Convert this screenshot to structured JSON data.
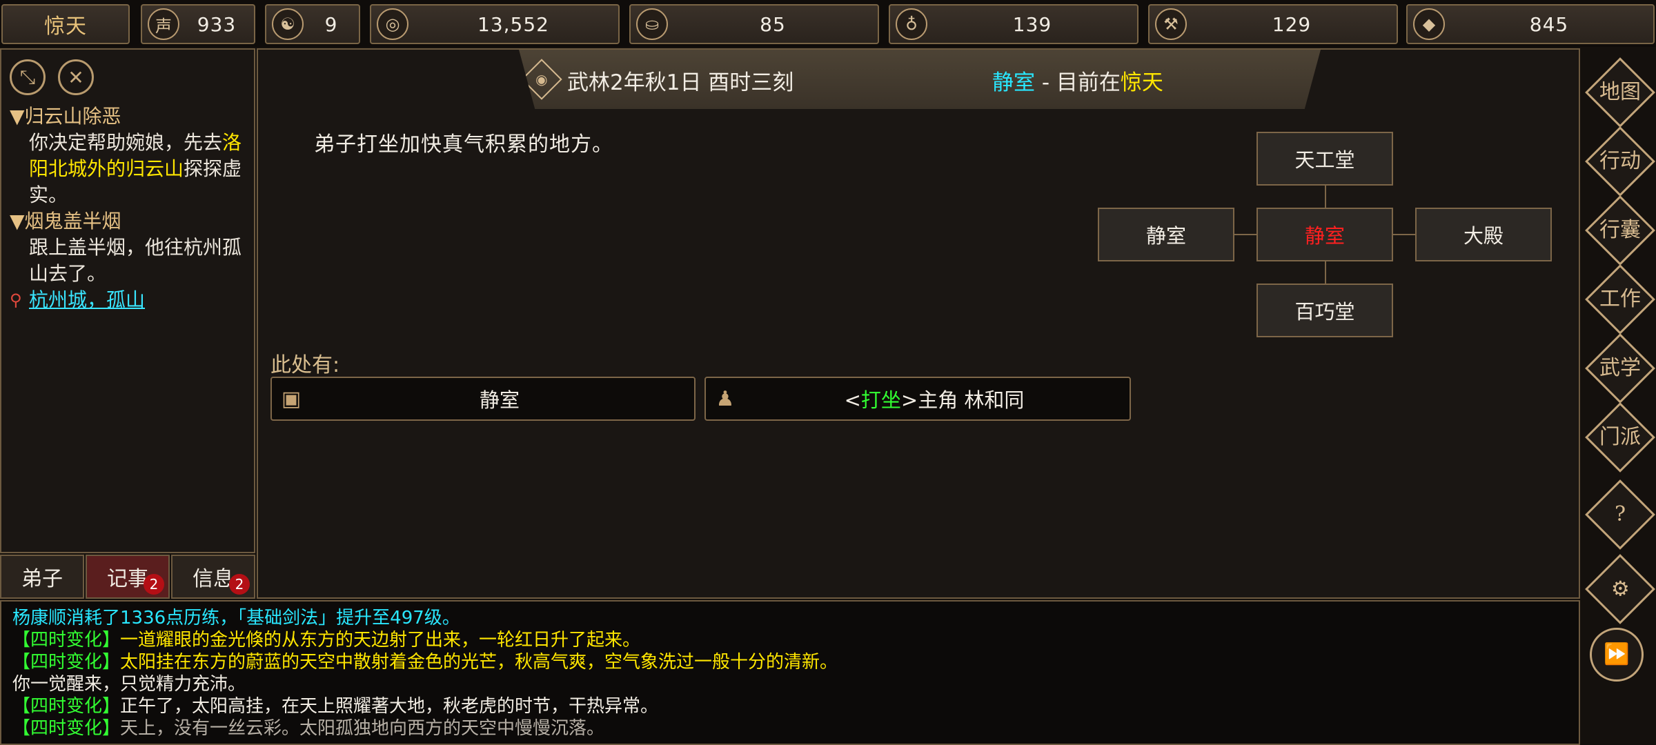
{
  "topbar": {
    "title": "惊天",
    "resources": [
      {
        "icon": "reputation-icon",
        "glyph": "声",
        "value": "933"
      },
      {
        "icon": "yinyang-icon",
        "glyph": "☯",
        "value": "9"
      },
      {
        "icon": "coin-icon",
        "glyph": "◎",
        "value": "13,552"
      },
      {
        "icon": "food-bowl-icon",
        "glyph": "⛀",
        "value": "85"
      },
      {
        "icon": "gourd-icon",
        "glyph": "♁",
        "value": "139"
      },
      {
        "icon": "wood-icon",
        "glyph": "⚒",
        "value": "129"
      },
      {
        "icon": "stone-icon",
        "glyph": "◆",
        "value": "845"
      }
    ]
  },
  "quests": [
    {
      "title": "▼归云山除恶",
      "body_pre": "你决定帮助婉娘，先去",
      "body_hl": "洛阳北城外的归云山",
      "body_post": "探探虚实。"
    },
    {
      "title": "▼烟鬼盖半烟",
      "body": "跟上盖半烟，他往杭州孤山去了。",
      "location": "杭州城，孤山"
    }
  ],
  "tabs": [
    {
      "label": "弟子",
      "badge": ""
    },
    {
      "label": "记事",
      "badge": "2"
    },
    {
      "label": "信息",
      "badge": "2"
    }
  ],
  "header": {
    "date": "武林2年秋1日 酉时三刻",
    "room": "静室",
    "sep": " - 目前在",
    "sect": "惊天"
  },
  "description": "弟子打坐加快真气积累的地方。",
  "map": {
    "north": "天工堂",
    "west": "静室",
    "center": "静室",
    "east": "大殿",
    "south": "百巧堂"
  },
  "here_label": "此处有:",
  "entities": [
    {
      "icon": "box-icon",
      "text": "静室"
    },
    {
      "icon": "person-icon",
      "pre": "<",
      "action": "打坐",
      "post": ">主角 林和同"
    }
  ],
  "side_menu": [
    "地图",
    "行动",
    "行囊",
    "工作",
    "武学",
    "门派"
  ],
  "log": [
    {
      "color": "cyan",
      "text": "杨康顺消耗了1336点历练，「基础剑法」提升至497级。"
    },
    {
      "tag": "【四时变化】",
      "color": "yellow",
      "text": "一道耀眼的金光倏的从东方的天边射了出来，一轮红日升了起来。"
    },
    {
      "tag": "【四时变化】",
      "color": "yellow",
      "text": "太阳挂在东方的蔚蓝的天空中散射着金色的光芒，秋高气爽，空气象洗过一般十分的清新。"
    },
    {
      "color": "white",
      "text": "你一觉醒来，只觉精力充沛。"
    },
    {
      "tag": "【四时变化】",
      "color": "white",
      "text": "正午了，太阳高挂，在天上照耀著大地，秋老虎的时节，干热异常。"
    },
    {
      "tag": "【四时变化】",
      "color": "grey",
      "text": "天上，没有一丝云彩。太阳孤独地向西方的天空中慢慢沉落。"
    }
  ]
}
